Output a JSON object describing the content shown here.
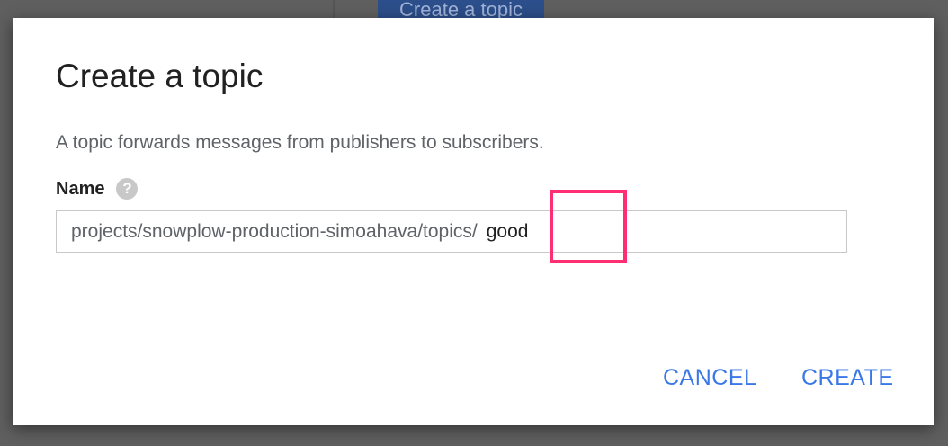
{
  "background": {
    "button_label": "Create a topic"
  },
  "dialog": {
    "title": "Create a topic",
    "description": "A topic forwards messages from publishers to subscribers.",
    "name_label": "Name",
    "help_icon": "?",
    "topic_prefix": "projects/snowplow-production-simoahava/topics/",
    "topic_value": "good",
    "cancel_label": "CANCEL",
    "create_label": "CREATE"
  },
  "colors": {
    "accent": "#3b78e7",
    "highlight": "#ff2e73",
    "backdrop": "#5f5f5f"
  }
}
